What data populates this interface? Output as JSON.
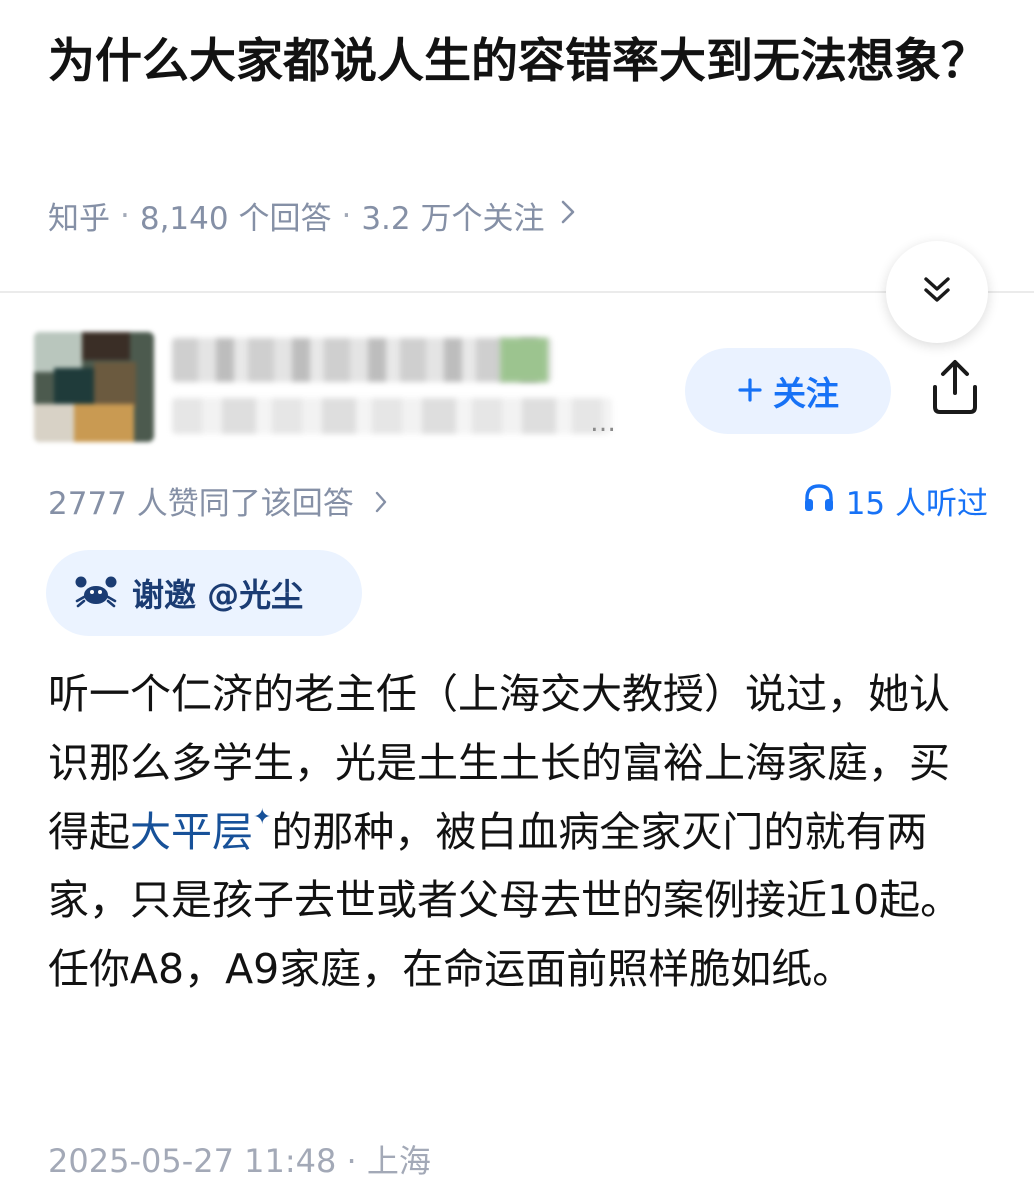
{
  "question": {
    "title": "为什么大家都说人生的容错率大到无法想象？",
    "source": "知乎",
    "answers_count": "8,140 个回答",
    "followers_count": "3.2 万个关注"
  },
  "author": {
    "follow_label": "关注"
  },
  "answer": {
    "likes_text": "2777 人赞同了该回答",
    "listen_text": "15 人听过",
    "invite_text": "谢邀 @光尘",
    "content_part1": "听一个仁济的老主任（上海交大教授）说过，她认识那么多学生，光是土生土长的富裕上海家庭，买得起",
    "content_link": "大平层",
    "content_link_mark": "✦",
    "content_part2": "的那种，被白血病全家灭门的就有两家，只是孩子去世或者父母去世的案例接近10起。任你A8，A9家庭，在命运面前照样脆如纸。",
    "timestamp": "2025-05-27 11:48",
    "location": "上海"
  },
  "colors": {
    "accent": "#1772f6",
    "link": "#175199",
    "meta_gray": "#8590a6",
    "invite_bg": "#ebf3ff",
    "follow_bg": "#eaf2ff"
  },
  "icons": [
    "collapse-double-chevron-down-icon",
    "plus-icon",
    "share-icon",
    "headphones-icon",
    "crab-icon",
    "chevron-right-icon"
  ]
}
